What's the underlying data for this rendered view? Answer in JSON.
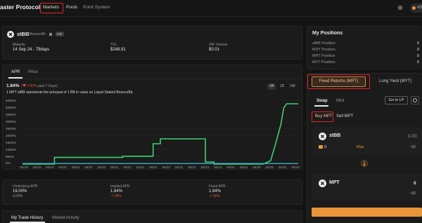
{
  "app": {
    "brand": "aster Protocol"
  },
  "nav": {
    "markets": "Markets",
    "pools": "Pools",
    "point_system": "Point System"
  },
  "wallet": {
    "label": "<0"
  },
  "market": {
    "name": "stBB",
    "source": "BounceBit",
    "badge": "Info",
    "maturity_label": "Maturity",
    "maturity_value": "14 Sep 24 - 79days",
    "tvl_label": "TVL",
    "tvl_value": "$248.91",
    "volume_label": "24h Volume",
    "volume_value": "$0.01"
  },
  "chart_tabs": {
    "apr": "APR",
    "price": "Price"
  },
  "chart_header": {
    "apr_value": "1.84%",
    "apr_change": "-7.00%",
    "apr_period": "past 7 Days",
    "description": "1 MPT stBB represents the principal of 1 BB in value on Liquid Staked BounceBit."
  },
  "ranges": [
    "1H",
    "1D",
    "1W"
  ],
  "chart_data": {
    "type": "line",
    "x_ticks": [
      "06/19",
      "06/19",
      "06/19",
      "06/20",
      "06/20",
      "06/20",
      "06/20",
      "06/21",
      "06/21",
      "06/21",
      "06/22",
      "06/22",
      "06/22",
      "06/23",
      "06/23",
      "06/24",
      "06/24",
      "06/24",
      "06/25",
      "06/25",
      "06/25",
      "06/26"
    ],
    "y_ticks": [
      "4500%",
      "4000%",
      "3500%",
      "3000%",
      "2500%",
      "2000%",
      "1500%",
      "1000%",
      "500%",
      "0%"
    ],
    "ylim": [
      0,
      4500
    ],
    "series": [
      {
        "color": "#3fcf73",
        "points": [
          [
            0,
            0
          ],
          [
            2.2,
            0
          ],
          [
            2.2,
            480
          ],
          [
            6.9,
            480
          ],
          [
            6.9,
            560
          ],
          [
            9.0,
            560
          ],
          [
            9.0,
            1450
          ],
          [
            9.5,
            1450
          ],
          [
            9.5,
            1800
          ],
          [
            12.6,
            1800
          ],
          [
            12.6,
            150
          ],
          [
            13.2,
            150
          ],
          [
            13.2,
            0
          ],
          [
            16.6,
            0
          ],
          [
            17.1,
            250
          ],
          [
            17.4,
            1300
          ],
          [
            17.8,
            2800
          ],
          [
            18.0,
            4000
          ],
          [
            18.2,
            4300
          ],
          [
            19.0,
            4300
          ]
        ]
      },
      {
        "color": "#37b4c8",
        "points": [
          [
            0,
            40
          ],
          [
            19.0,
            40
          ]
        ]
      }
    ]
  },
  "stats": {
    "underlying_label": "Underlying APR",
    "underlying_value": "19.00%",
    "underlying_sub": "0.00%",
    "implied_label": "Implied APR",
    "implied_value": "1.84%",
    "implied_sub": "-7.00%",
    "fixed_label": "Fixed APR",
    "fixed_value": "1.84%",
    "fixed_sub": "-7.00%"
  },
  "history_tabs": {
    "trade": "My Trade History",
    "activity": "Market Activity"
  },
  "positions": {
    "title": "My Positions",
    "rows": [
      {
        "label": "stBB Position",
        "value": "0"
      },
      {
        "label": "MSY Position",
        "value": "0"
      },
      {
        "label": "MPT Position",
        "value": "0"
      },
      {
        "label": "MYT Position",
        "value": "0"
      }
    ]
  },
  "mode": {
    "fixed": "Fixed Returns (MPT)",
    "long": "Long Yield (MYT)"
  },
  "trade": {
    "swap": "Swap",
    "mint": "Mint",
    "go_to_lp": "Go to LP",
    "buy": "Buy MPT",
    "sell": "Sell MPT",
    "input_token": "stBB",
    "input_amount": "0.00",
    "balance": "0",
    "max": "Max",
    "input_usd": "~$0",
    "output_token": "MPT",
    "output_amount": "0",
    "output_usd": "~$0"
  },
  "colors": {
    "accent": "#e8953a",
    "highlight": "#e0242a",
    "positive": "#3fcf73",
    "negative": "#e0533c"
  }
}
